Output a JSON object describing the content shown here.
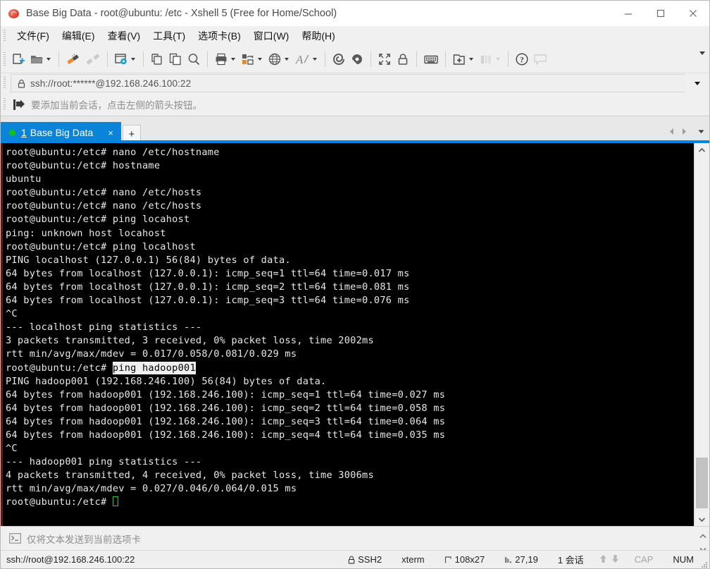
{
  "window": {
    "title": "Base Big Data - root@ubuntu: /etc - Xshell 5 (Free for Home/School)",
    "app_icon": "xshell-icon",
    "minimize_label": "—",
    "maximize_label": "□",
    "close_label": "✕"
  },
  "menu": {
    "items": [
      {
        "label": "文件(F)"
      },
      {
        "label": "编辑(E)"
      },
      {
        "label": "查看(V)"
      },
      {
        "label": "工具(T)"
      },
      {
        "label": "选项卡(B)"
      },
      {
        "label": "窗口(W)"
      },
      {
        "label": "帮助(H)"
      }
    ]
  },
  "toolbar": {
    "buttons": [
      {
        "name": "new-session-icon",
        "has_caret": false,
        "disabled": false
      },
      {
        "name": "open-folder-icon",
        "has_caret": true,
        "disabled": false
      },
      {
        "name": "connect-icon",
        "has_caret": false,
        "disabled": false
      },
      {
        "name": "disconnect-icon",
        "has_caret": false,
        "disabled": true
      },
      {
        "name": "session-properties-icon",
        "has_caret": true,
        "disabled": false
      },
      {
        "name": "copy-session-icon",
        "has_caret": false,
        "disabled": false
      },
      {
        "name": "paste-icon",
        "has_caret": false,
        "disabled": false
      },
      {
        "name": "find-icon",
        "has_caret": false,
        "disabled": false
      },
      {
        "name": "print-icon",
        "has_caret": true,
        "disabled": false
      },
      {
        "name": "transfer-icon",
        "has_caret": true,
        "disabled": false
      },
      {
        "name": "encoding-globe-icon",
        "has_caret": true,
        "disabled": false
      },
      {
        "name": "font-icon",
        "has_caret": true,
        "disabled": false
      },
      {
        "name": "xshell-icon",
        "has_caret": false,
        "disabled": false
      },
      {
        "name": "xftp-icon",
        "has_caret": false,
        "disabled": false
      },
      {
        "name": "fullscreen-icon",
        "has_caret": false,
        "disabled": false
      },
      {
        "name": "lock-icon",
        "has_caret": false,
        "disabled": false
      },
      {
        "name": "keyboard-icon",
        "has_caret": false,
        "disabled": false
      },
      {
        "name": "add-to-folder-icon",
        "has_caret": true,
        "disabled": false
      },
      {
        "name": "layout-columns-icon",
        "has_caret": true,
        "disabled": true
      },
      {
        "name": "help-icon",
        "has_caret": false,
        "disabled": false
      },
      {
        "name": "chat-icon",
        "has_caret": false,
        "disabled": true
      }
    ],
    "overflow_label": "toolbar-overflow"
  },
  "address": {
    "lock_icon": "lock-icon",
    "value": "ssh://root:******@192.168.246.100:22",
    "dropdown_icon": "chevron-down-icon"
  },
  "hint": {
    "icon": "add-session-arrow-icon",
    "text": "要添加当前会话，点击左侧的箭头按钮。"
  },
  "tabs": {
    "items": [
      {
        "number": "1",
        "label": "Base Big Data",
        "active": true,
        "status_dot": "connected",
        "close_label": "×"
      }
    ],
    "new_tab_label": "+",
    "nav_prev_icon": "chevron-left-icon",
    "nav_next_icon": "chevron-right-icon",
    "nav_list_icon": "chevron-down-icon"
  },
  "terminal": {
    "prompt": "root@ubuntu:/etc#",
    "selection_text": "ping hadoop001",
    "cursor_icon": "drag-copy-cursor",
    "lines": [
      {
        "text": "root@ubuntu:/etc# nano /etc/hostname"
      },
      {
        "text": "root@ubuntu:/etc# hostname"
      },
      {
        "text": "ubuntu"
      },
      {
        "text": "root@ubuntu:/etc# nano /etc/hosts"
      },
      {
        "text": "root@ubuntu:/etc# nano /etc/hosts"
      },
      {
        "text": "root@ubuntu:/etc# ping locahost"
      },
      {
        "text": "ping: unknown host locahost"
      },
      {
        "text": "root@ubuntu:/etc# ping localhost"
      },
      {
        "text": "PING localhost (127.0.0.1) 56(84) bytes of data."
      },
      {
        "text": "64 bytes from localhost (127.0.0.1): icmp_seq=1 ttl=64 time=0.017 ms"
      },
      {
        "text": "64 bytes from localhost (127.0.0.1): icmp_seq=2 ttl=64 time=0.081 ms"
      },
      {
        "text": "64 bytes from localhost (127.0.0.1): icmp_seq=3 ttl=64 time=0.076 ms"
      },
      {
        "text": "^C"
      },
      {
        "text": "--- localhost ping statistics ---"
      },
      {
        "text": "3 packets transmitted, 3 received, 0% packet loss, time 2002ms"
      },
      {
        "text": "rtt min/avg/max/mdev = 0.017/0.058/0.081/0.029 ms"
      },
      {
        "text": "root@ubuntu:/etc# ",
        "selected_suffix": "ping hadoop001"
      },
      {
        "text": "PING hadoop001 (192.168.246.100) 56(84) bytes of data."
      },
      {
        "text": "64 bytes from hadoop001 (192.168.246.100): icmp_seq=1 ttl=64 time=0.027 ms"
      },
      {
        "text": "64 bytes from hadoop001 (192.168.246.100): icmp_seq=2 ttl=64 time=0.058 ms"
      },
      {
        "text": "64 bytes from hadoop001 (192.168.246.100): icmp_seq=3 ttl=64 time=0.064 ms"
      },
      {
        "text": "64 bytes from hadoop001 (192.168.246.100): icmp_seq=4 ttl=64 time=0.035 ms"
      },
      {
        "text": "^C"
      },
      {
        "text": "--- hadoop001 ping statistics ---"
      },
      {
        "text": "4 packets transmitted, 4 received, 0% packet loss, time 3006ms"
      },
      {
        "text": "rtt min/avg/max/mdev = 0.027/0.046/0.064/0.015 ms"
      },
      {
        "text": "root@ubuntu:/etc# ",
        "cursor": true
      }
    ]
  },
  "sendbar": {
    "icon": "terminal-prompt-icon",
    "text": "仅将文本发送到当前选项卡"
  },
  "statusbar": {
    "connection": "ssh://root@192.168.246.100:22",
    "protocol_icon": "lock-icon",
    "protocol": "SSH2",
    "terminal_type": "xterm",
    "size_icon": "resize-icon",
    "size": "108x27",
    "position_icon": "cursor-position-icon",
    "position": "27,19",
    "sessions": "1 会话",
    "upload_icon": "arrow-up-icon",
    "download_icon": "arrow-down-icon",
    "caps": "CAP",
    "num": "NUM"
  },
  "colors": {
    "accent": "#0a84d8",
    "terminal_bg": "#000000",
    "terminal_fg": "#e8e8e8",
    "selection_bg": "#efefef",
    "cursor": "#20d020",
    "chrome": "#f0f0f0",
    "status_dot": "#12c212"
  }
}
